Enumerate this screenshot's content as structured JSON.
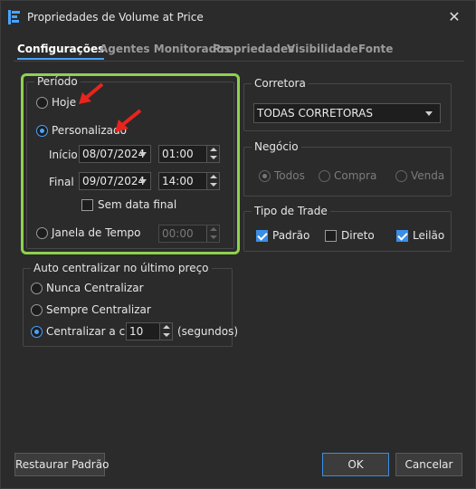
{
  "window": {
    "title": "Propriedades de Volume at Price",
    "icon": "app-logo-icon",
    "close_icon": "close-icon"
  },
  "tabs": [
    {
      "label": "Configurações",
      "active": true
    },
    {
      "label": "Agentes Monitorados",
      "active": false
    },
    {
      "label": "Propriedades",
      "active": false
    },
    {
      "label": "Visibilidade",
      "active": false
    },
    {
      "label": "Fonte",
      "active": false
    }
  ],
  "periodo": {
    "legend": "Período",
    "hoje": {
      "label": "Hoje",
      "selected": false
    },
    "personalizado": {
      "label": "Personalizado",
      "selected": true
    },
    "inicio": {
      "label": "Início",
      "date": "08/07/2024",
      "time": "01:00"
    },
    "final": {
      "label": "Final",
      "date": "09/07/2024",
      "time": "14:00"
    },
    "sem_data_final": {
      "label": "Sem data final",
      "checked": false
    },
    "janela": {
      "label": "Janela de Tempo",
      "selected": false,
      "value": "00:00"
    }
  },
  "auto_centralizar": {
    "legend": "Auto centralizar no último preço",
    "nunca": {
      "label": "Nunca Centralizar",
      "selected": false
    },
    "sempre": {
      "label": "Sempre Centralizar",
      "selected": false
    },
    "a_cada": {
      "label": "Centralizar a cada",
      "selected": true,
      "value": "10",
      "unit": "(segundos)"
    }
  },
  "corretora": {
    "legend": "Corretora",
    "selected": "TODAS CORRETORAS"
  },
  "negocio": {
    "legend": "Negócio",
    "options": [
      {
        "label": "Todos",
        "selected": true
      },
      {
        "label": "Compra",
        "selected": false
      },
      {
        "label": "Venda",
        "selected": false
      }
    ]
  },
  "tipo_trade": {
    "legend": "Tipo de Trade",
    "options": [
      {
        "label": "Padrão",
        "checked": true
      },
      {
        "label": "Direto",
        "checked": false
      },
      {
        "label": "Leilão",
        "checked": true
      }
    ]
  },
  "buttons": {
    "restore": "Restaurar Padrão",
    "ok": "OK",
    "cancel": "Cancelar"
  },
  "annotations": {
    "highlight_color": "#8fd14f",
    "arrow_color": "#e8241c",
    "accent": "#4aa3ff"
  }
}
